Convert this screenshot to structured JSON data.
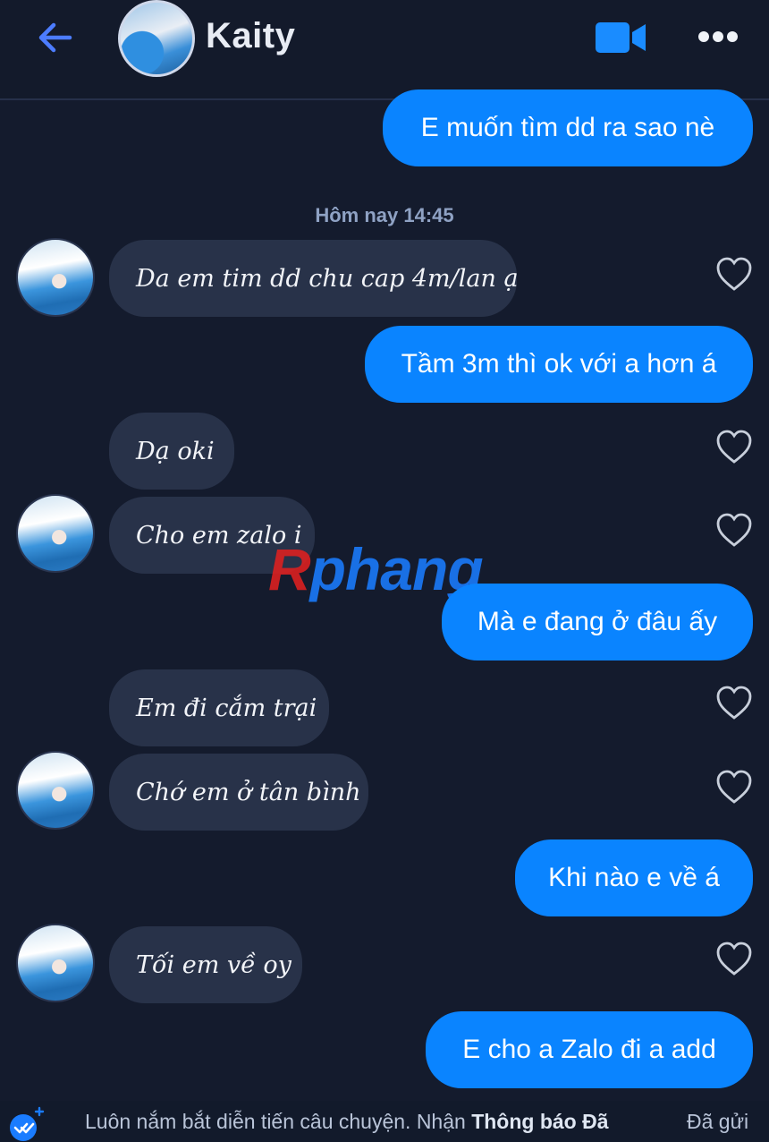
{
  "header": {
    "contact_name": "Kaity",
    "back_icon": "arrow-left-icon",
    "video_icon": "video-camera-icon",
    "more_icon": "more-horizontal-icon"
  },
  "timestamp": "Hôm nay 14:45",
  "messages": [
    {
      "direction": "outgoing",
      "text": "E muốn tìm dd ra sao nè"
    },
    {
      "direction": "incoming",
      "text": "Da em tim dd chu cap 4m/lan ạ"
    },
    {
      "direction": "outgoing",
      "text": "Tầm 3m thì ok với a hơn á"
    },
    {
      "direction": "incoming",
      "text": "Dạ oki"
    },
    {
      "direction": "incoming",
      "text": "Cho em zalo i"
    },
    {
      "direction": "outgoing",
      "text": "Mà e đang ở đâu ấy"
    },
    {
      "direction": "incoming",
      "text": "Em đi cắm trại"
    },
    {
      "direction": "incoming",
      "text": "Chớ em ở tân bình"
    },
    {
      "direction": "outgoing",
      "text": "Khi nào e về á"
    },
    {
      "direction": "incoming",
      "text": "Tối em về oy"
    },
    {
      "direction": "outgoing",
      "text": "E cho a Zalo đi a add"
    }
  ],
  "watermark": {
    "first": "R",
    "rest": "phang"
  },
  "footer": {
    "text": "Luôn nắm bắt diễn tiến câu chuyện. Nhận",
    "link": "Thông báo Đã",
    "status": "Đã gửi"
  },
  "colors": {
    "background": "#141b2d",
    "outgoing_bubble": "#0a84ff",
    "incoming_bubble": "#283249",
    "accent": "#1a7cff"
  }
}
